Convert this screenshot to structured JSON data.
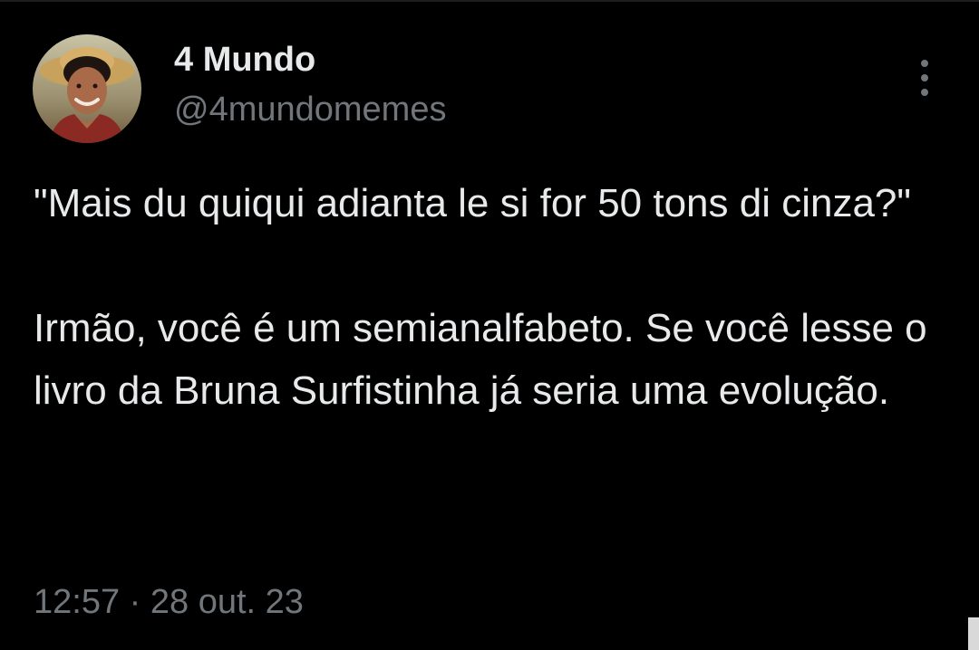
{
  "tweet": {
    "author": {
      "display_name": "4 Mundo",
      "handle": "@4mundomemes"
    },
    "text": {
      "paragraph_1": "\"Mais du quiqui adianta le si for 50 tons di cinza?\"",
      "paragraph_2": "Irmão, você é um semianalfabeto. Se você lesse o livro da Bruna Surfistinha já seria uma evolução."
    },
    "time": "12:57",
    "separator": "·",
    "date": "28 out. 23"
  },
  "icons": {
    "more": "more-vertical-icon"
  },
  "colors": {
    "background": "#000000",
    "primary_text": "#e7e9ea",
    "secondary_text": "#71767b"
  }
}
